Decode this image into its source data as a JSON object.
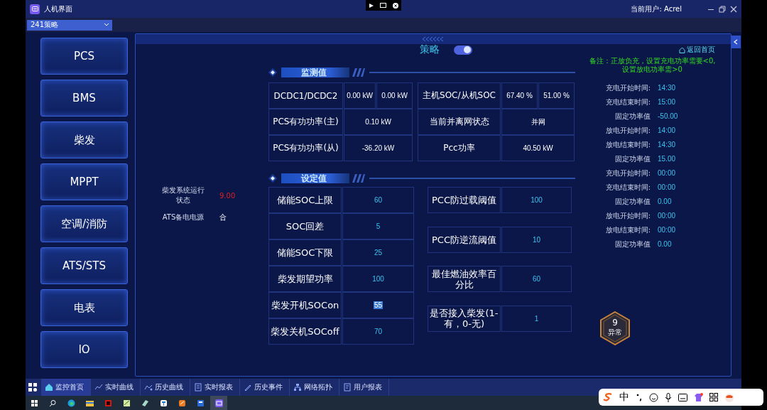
{
  "window": {
    "title": "人机界面",
    "user_label": "当前用户:",
    "user": "Acrel"
  },
  "strategy_select": {
    "value": "241策略"
  },
  "sidebar": {
    "items": [
      {
        "label": "PCS",
        "selected": false
      },
      {
        "label": "BMS",
        "selected": false
      },
      {
        "label": "柴发",
        "selected": false
      },
      {
        "label": "MPPT",
        "selected": false
      },
      {
        "label": "空调/消防",
        "selected": false
      },
      {
        "label": "ATS/STS",
        "selected": false
      },
      {
        "label": "电表",
        "selected": false
      },
      {
        "label": "IO",
        "selected": false
      }
    ]
  },
  "panel": {
    "title": "策略",
    "strategy_on": true,
    "home_link": "返回首页",
    "note": [
      "备注：正放负充，设置充电功率需要<0,",
      "设置放电功率需>0"
    ]
  },
  "status": [
    {
      "label": "柴发系统运行状态",
      "value": "9.00",
      "alarm": true
    },
    {
      "label": "ATS备电电源",
      "value": "合",
      "alarm": false
    }
  ],
  "monitor": {
    "title": "监测值",
    "rows": [
      {
        "left": {
          "label": "DCDC1/DCDC2",
          "values": [
            "0.00 kW",
            "0.00 kW"
          ]
        },
        "right": {
          "label": "主机SOC/从机SOC",
          "values": [
            "67.40 %",
            "51.00 %"
          ]
        }
      },
      {
        "left": {
          "label": "PCS有功功率(主)",
          "values": [
            "0.10 kW"
          ]
        },
        "right": {
          "label": "当前并离网状态",
          "values": [
            "并网"
          ]
        }
      },
      {
        "left": {
          "label": "PCS有功功率(从)",
          "values": [
            "-36.20 kW"
          ]
        },
        "right": {
          "label": "Pcc功率",
          "values": [
            "40.50 kW"
          ]
        }
      }
    ]
  },
  "settings": {
    "title": "设定值",
    "left": [
      {
        "label": "储能SOC上限",
        "value": "60",
        "selected": false
      },
      {
        "label": "SOC回差",
        "value": "5",
        "selected": false
      },
      {
        "label": "储能SOC下限",
        "value": "25",
        "selected": false
      },
      {
        "label": "柴发期望功率",
        "value": "100",
        "selected": false
      },
      {
        "label": "柴发开机SOCon",
        "value": "55",
        "selected": true
      },
      {
        "label": "柴发关机SOCoff",
        "value": "70",
        "selected": false
      }
    ],
    "right": [
      {
        "label": "PCC防过载阈值",
        "value": "100",
        "selected": false
      },
      {
        "label": "PCC防逆流阈值",
        "value": "10",
        "selected": false
      },
      {
        "label": "最佳燃油效率百分比",
        "value": "60",
        "selected": false
      },
      {
        "label": "是否接入柴发(1-有，0-无)",
        "value": "1",
        "selected": false
      }
    ]
  },
  "schedule": [
    {
      "label": "充电开始时间:",
      "value": "14:30"
    },
    {
      "label": "充电结束时间:",
      "value": "15:00"
    },
    {
      "label": "固定功率值",
      "value": "-50.00"
    },
    {
      "label": "放电开始时间:",
      "value": "14:00"
    },
    {
      "label": "放电结束时间:",
      "value": "14:30"
    },
    {
      "label": "固定功率值",
      "value": "15.00"
    },
    {
      "label": "充电开始时间:",
      "value": "00:00"
    },
    {
      "label": "充电结束时间:",
      "value": "00:00"
    },
    {
      "label": "固定功率值",
      "value": "0.00"
    },
    {
      "label": "放电开始时间:",
      "value": "00:00"
    },
    {
      "label": "放电结束时间:",
      "value": "00:00"
    },
    {
      "label": "固定功率值",
      "value": "0.00"
    }
  ],
  "alarm_badge": {
    "count": "9",
    "label": "异常"
  },
  "bottom_nav": {
    "tabs": [
      {
        "label": "监控首页",
        "selected": true
      },
      {
        "label": "实时曲线",
        "selected": false
      },
      {
        "label": "历史曲线",
        "selected": false
      },
      {
        "label": "实时报表",
        "selected": false
      },
      {
        "label": "历史事件",
        "selected": false
      },
      {
        "label": "网络拓扑",
        "selected": false
      },
      {
        "label": "用户报表",
        "selected": false
      }
    ]
  },
  "ime_bar": {
    "mode": "中"
  }
}
